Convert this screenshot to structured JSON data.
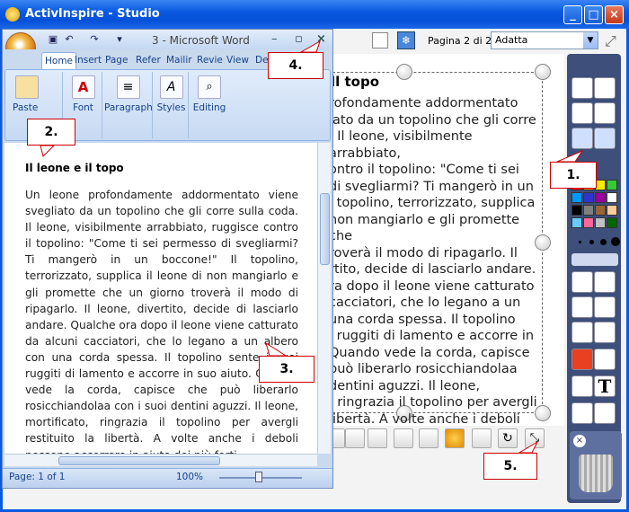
{
  "activinspire": {
    "title": "ActivInspire - Studio",
    "page_label": "Pagina 2 di 2",
    "zoom_value": "Adatta",
    "canvas_title": "ll topo",
    "canvas_text": "rofondamente addormentato\niato da un topolino che gli corre\n. Il leone, visibilmente arrabbiato,\nontro il topolino: \"Come ti sei\ndi svegliarmi? Ti mangerò in un\nl topolino, terrorizzato, supplica\nnon mangiarlo e gli promette che\nroverà il modo di ripagarlo. Il\nrtito, decide di lasciarlo andare.\nra dopo il leone viene catturato\ncacciatori, che lo legano a un\nuna corda spessa. Il topolino\ni ruggiti di lamento e accorre in\nQuando vede la corda, capisce\npuò liberarlo rosicchiandolaa\ndentini aguzzi. Il leone,\n, ringrazia il topolino per avergli\nlibertà. A volte anche i deboli\nccorrere in aiuto dei più forti.",
    "colors": [
      "#ff0000",
      "#ff8800",
      "#ffee00",
      "#33cc33",
      "#0099ff",
      "#3333cc",
      "#990099",
      "#ffffff",
      "#000000",
      "#808080",
      "#996633",
      "#ffcc99",
      "#66ccff",
      "#ff6699",
      "#c0c0c0",
      "#006600"
    ]
  },
  "word": {
    "title": "3 - Microsoft Word",
    "tabs": [
      "Home",
      "Insert",
      "Page",
      "Refer",
      "Mailir",
      "Revie",
      "View",
      "Des"
    ],
    "groups": {
      "clipboard": "Paste",
      "font": "Font",
      "paragraph": "Paragraph",
      "styles": "Styles",
      "editing": "Editing"
    },
    "doc_title": "Il leone e il topo",
    "doc_body": "Un leone profondamente addormentato viene svegliato da un topolino che gli corre sulla coda. Il leone, visibilmente arrabbiato, ruggisce contro il topolino: \"Come ti sei permesso di svegliarmi? Ti mangerò in un boccone!\" Il topolino, terrorizzato, supplica il leone di non mangiarlo e gli promette che un giorno troverà il modo di ripagarlo. Il leone, divertito, decide di lasciarlo andare. Qualche ora dopo il leone viene catturato da alcuni cacciatori, che lo legano a un albero con una corda spessa. Il topolino sente i suoi ruggiti di lamento e accorre in suo aiuto. Quando vede la corda, capisce che può liberarlo rosicchiandolaa con i suoi dentini aguzzi. Il leone, mortificato, ringrazia il topolino per avergli restituito la libertà. A volte anche i deboli possono accorrere in aiuto dei più forti.",
    "status_page": "Page: 1 of 1",
    "status_zoom": "100%"
  },
  "callouts": [
    "1.",
    "2.",
    "3.",
    "4.",
    "5."
  ]
}
